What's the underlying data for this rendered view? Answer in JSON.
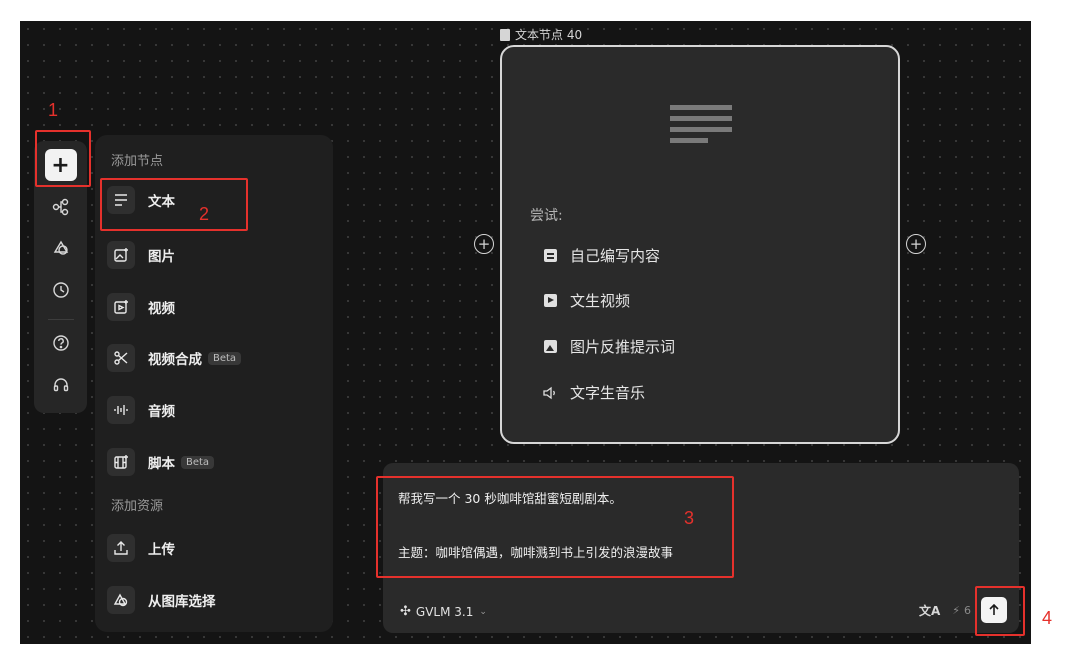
{
  "toolbar": {
    "items": [
      {
        "name": "add-node-button",
        "icon": "plus-icon",
        "glyph": "+"
      },
      {
        "name": "workflow-button",
        "icon": "nodes-icon",
        "glyph": "⌘"
      },
      {
        "name": "assets-button",
        "icon": "shapes-icon",
        "glyph": "⟁"
      },
      {
        "name": "history-button",
        "icon": "clock-icon",
        "glyph": "◷"
      },
      {
        "name": "help-button",
        "icon": "help-icon",
        "glyph": "?"
      },
      {
        "name": "support-button",
        "icon": "headset-icon",
        "glyph": "☊"
      }
    ]
  },
  "panel": {
    "add_node_heading": "添加节点",
    "nodes": [
      {
        "label": "文本",
        "icon": "text-lines-icon",
        "glyph": "☰",
        "beta": ""
      },
      {
        "label": "图片",
        "icon": "image-sparkle-icon",
        "glyph": "▣",
        "beta": ""
      },
      {
        "label": "视频",
        "icon": "video-sparkle-icon",
        "glyph": "▶",
        "beta": ""
      },
      {
        "label": "视频合成",
        "icon": "scissors-icon",
        "glyph": "✂",
        "beta": "Beta"
      },
      {
        "label": "音频",
        "icon": "audio-wave-icon",
        "glyph": "⫶",
        "beta": ""
      },
      {
        "label": "脚本",
        "icon": "film-script-icon",
        "glyph": "▦",
        "beta": "Beta"
      }
    ],
    "add_resource_heading": "添加资源",
    "resources": [
      {
        "label": "上传",
        "icon": "upload-icon",
        "glyph": "⇪"
      },
      {
        "label": "从图库选择",
        "icon": "library-icon",
        "glyph": "⟁"
      }
    ]
  },
  "node": {
    "title": "文本节点 40",
    "try_label": "尝试:",
    "suggestions": [
      {
        "label": "自己编写内容",
        "icon": "document-icon"
      },
      {
        "label": "文生视频",
        "icon": "play-icon"
      },
      {
        "label": "图片反推提示词",
        "icon": "picture-icon"
      },
      {
        "label": "文字生音乐",
        "icon": "speaker-icon"
      }
    ]
  },
  "prompt": {
    "line1": "帮我写一个 30 秒咖啡馆甜蜜短剧剧本。",
    "line2": "主题：咖啡馆偶遇，咖啡溅到书上引发的浪漫故事",
    "model": "GVLM 3.1",
    "credits": "6"
  },
  "annotations": {
    "n1": "1",
    "n2": "2",
    "n3": "3",
    "n4": "4",
    "color": "#e5312c"
  }
}
